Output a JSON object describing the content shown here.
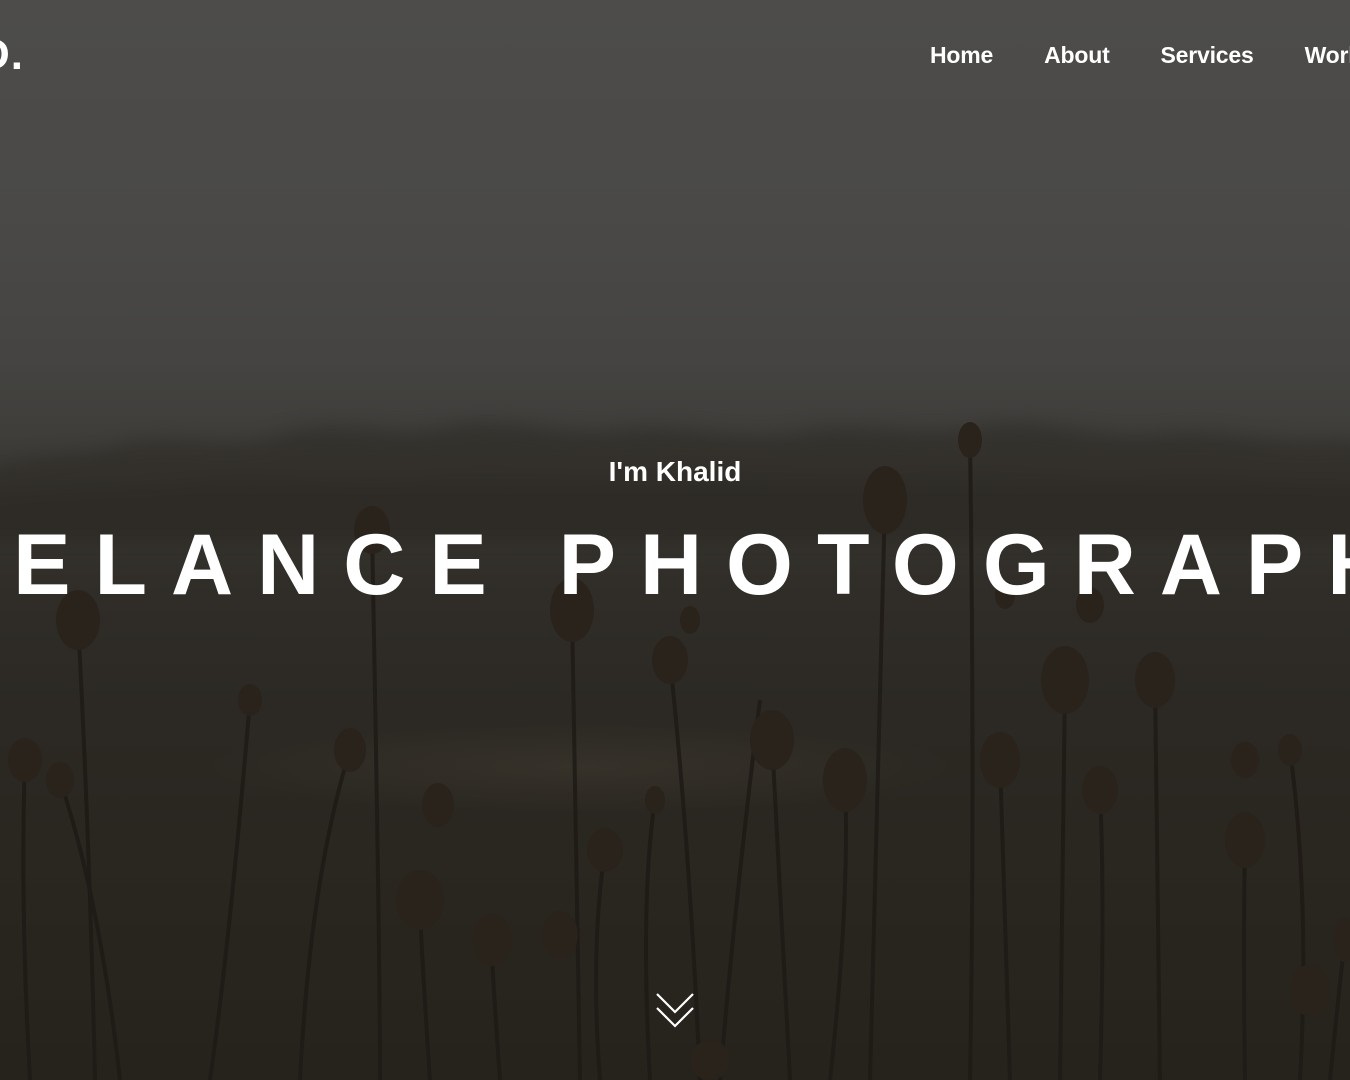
{
  "nav": {
    "logo": "D.",
    "items": [
      {
        "label": "Home"
      },
      {
        "label": "About"
      },
      {
        "label": "Services"
      },
      {
        "label": "Work"
      }
    ]
  },
  "hero": {
    "intro": "I'm Khalid",
    "headline": "FREELANCE PHOTOGRAPHER",
    "scroll_icon": "double-chevron-down-icon"
  },
  "colors": {
    "text": "#ffffff",
    "overlay": "#3f3e3b"
  }
}
